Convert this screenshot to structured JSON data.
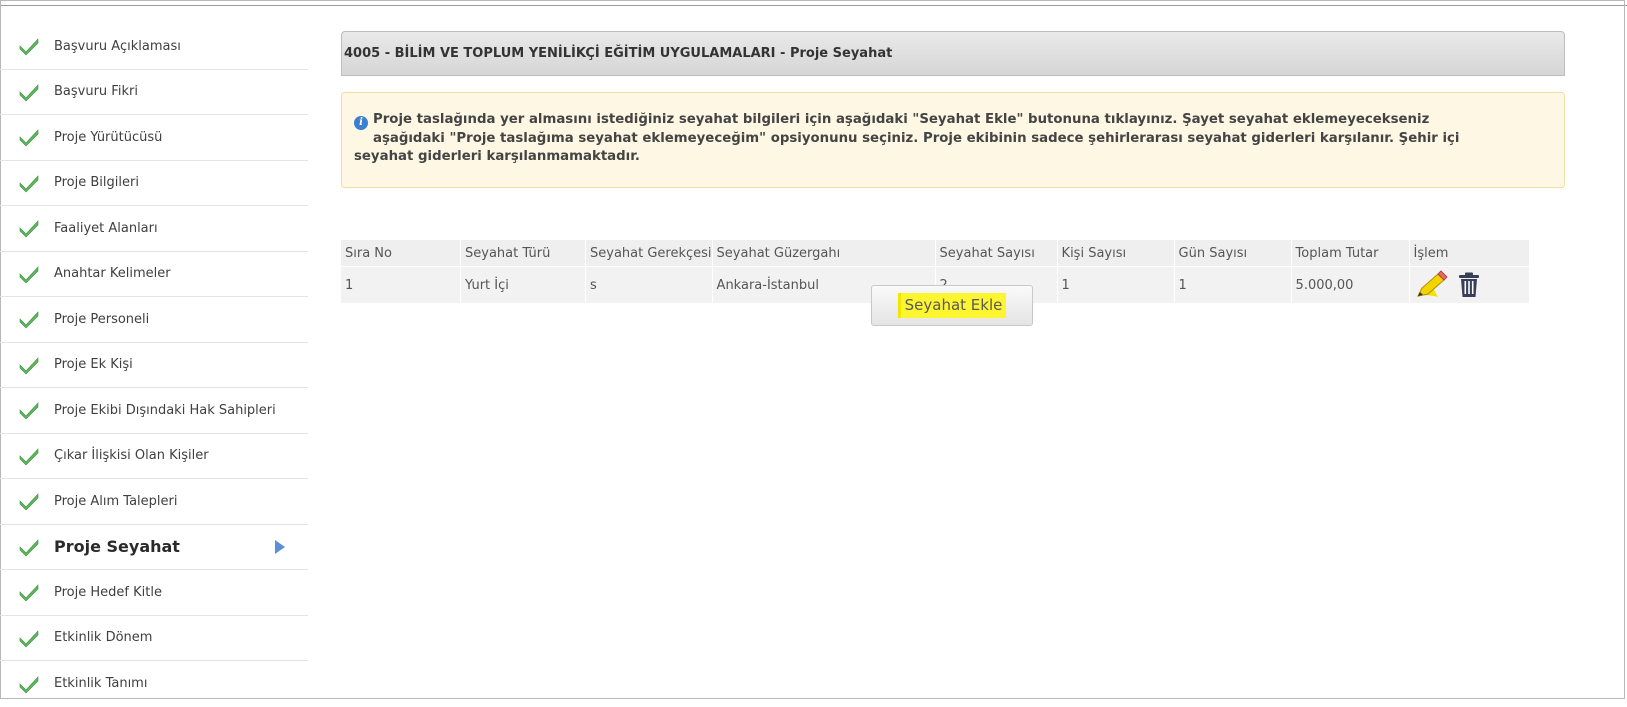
{
  "sidebar": {
    "items": [
      {
        "label": "Başvuru Açıklaması"
      },
      {
        "label": "Başvuru Fikri"
      },
      {
        "label": "Proje Yürütücüsü"
      },
      {
        "label": "Proje Bilgileri"
      },
      {
        "label": "Faaliyet Alanları"
      },
      {
        "label": "Anahtar Kelimeler"
      },
      {
        "label": "Proje Personeli"
      },
      {
        "label": "Proje Ek Kişi"
      },
      {
        "label": "Proje Ekibi Dışındaki Hak Sahipleri"
      },
      {
        "label": "Çıkar İlişkisi Olan Kişiler"
      },
      {
        "label": "Proje Alım Talepleri"
      },
      {
        "label": "Proje Seyahat"
      },
      {
        "label": "Proje Hedef Kitle"
      },
      {
        "label": "Etkinlik Dönem"
      },
      {
        "label": "Etkinlik Tanımı"
      }
    ],
    "active_label": "Proje Seyahat",
    "check_color": "#5cb85c"
  },
  "header": {
    "title": "4005 - BİLİM VE TOPLUM YENİLİKÇİ EĞİTİM UYGULAMALARI - Proje Seyahat"
  },
  "info": {
    "icon": "info-icon",
    "line1": "Proje taslağında yer almasını istediğiniz seyahat bilgileri için aşağıdaki \"Seyahat Ekle\" butonuna tıklayınız. Şayet seyahat eklemeyecekseniz",
    "line2": "aşağıdaki \"Proje taslağıma seyahat eklemeyeceğim\" opsiyonunu seçiniz. Proje ekibinin sadece şehirlerarası seyahat giderleri karşılanır. Şehir içi",
    "line3": "seyahat giderleri karşılanmamaktadır."
  },
  "table": {
    "columns": [
      "Sıra No",
      "Seyahat Türü",
      "Seyahat Gerekçesi",
      "Seyahat Güzergahı",
      "Seyahat Sayısı",
      "Kişi Sayısı",
      "Gün Sayısı",
      "Toplam Tutar",
      "İşlem"
    ],
    "rows": [
      [
        "1",
        "Yurt İçi",
        "s",
        "Ankara-İstanbul",
        "2",
        "1",
        "1",
        "5.000,00"
      ]
    ]
  },
  "actions": {
    "add_label": "Seyahat Ekle",
    "highlight_color": "#fcf52f"
  }
}
